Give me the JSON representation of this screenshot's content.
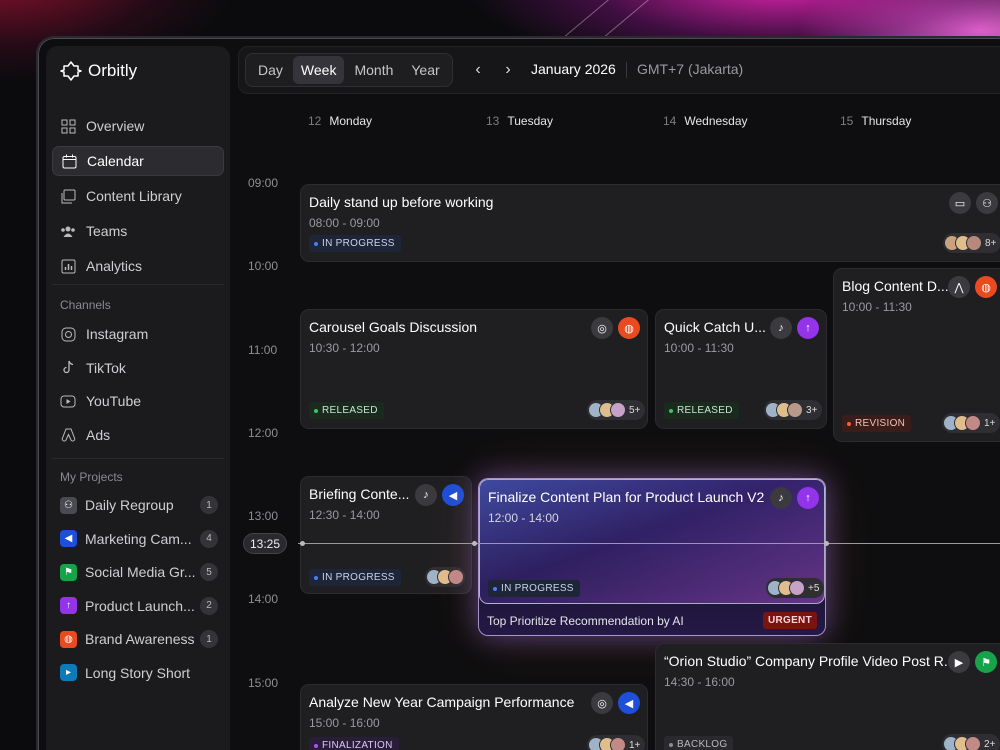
{
  "app": {
    "name": "Orbitly"
  },
  "nav": [
    {
      "label": "Overview",
      "icon": "overview-icon",
      "active": false
    },
    {
      "label": "Calendar",
      "icon": "calendar-icon",
      "active": true
    },
    {
      "label": "Content Library",
      "icon": "library-icon",
      "active": false
    },
    {
      "label": "Teams",
      "icon": "teams-icon",
      "active": false
    },
    {
      "label": "Analytics",
      "icon": "analytics-icon",
      "active": false
    }
  ],
  "channels": {
    "label": "Channels",
    "items": [
      {
        "label": "Instagram",
        "icon": "instagram-icon"
      },
      {
        "label": "TikTok",
        "icon": "tiktok-icon"
      },
      {
        "label": "YouTube",
        "icon": "youtube-icon"
      },
      {
        "label": "Ads",
        "icon": "ads-icon"
      }
    ]
  },
  "projects": {
    "label": "My Projects",
    "items": [
      {
        "label": "Daily Regroup",
        "count": "1",
        "color": "#4a4a52",
        "icon": "teams-icon"
      },
      {
        "label": "Marketing Cam...",
        "count": "4",
        "color": "#1d4fd8",
        "icon": "megaphone-icon"
      },
      {
        "label": "Social Media Gr...",
        "count": "5",
        "color": "#16a34a",
        "icon": "flag-icon"
      },
      {
        "label": "Product Launch...",
        "count": "2",
        "color": "#9333ea",
        "icon": "arrow-up-icon"
      },
      {
        "label": "Brand Awareness",
        "count": "1",
        "color": "#ea4a1f",
        "icon": "globe-icon"
      },
      {
        "label": "Long Story Short",
        "count": "",
        "color": "#0e7ab8",
        "icon": "video-icon"
      }
    ]
  },
  "toolbar": {
    "views": [
      "Day",
      "Week",
      "Month",
      "Year"
    ],
    "active_view": "Week",
    "month": "January 2026",
    "timezone": "GMT+7 (Jakarta)"
  },
  "days": [
    {
      "num": "12",
      "name": "Monday"
    },
    {
      "num": "13",
      "name": "Tuesday"
    },
    {
      "num": "14",
      "name": "Wednesday"
    },
    {
      "num": "15",
      "name": "Thursday"
    }
  ],
  "times": [
    "09:00",
    "10:00",
    "11:00",
    "12:00",
    "13:00",
    "14:00",
    "15:00"
  ],
  "now": "13:25",
  "events": {
    "standup": {
      "title": "Daily stand up before working",
      "time": "08:00 - 09:00",
      "status": "IN PROGRESS",
      "more": "8+"
    },
    "carousel": {
      "title": "Carousel Goals Discussion",
      "time": "10:30 - 12:00",
      "status": "RELEASED",
      "more": "5+"
    },
    "catchup": {
      "title": "Quick Catch U...",
      "time": "10:00 - 11:30",
      "status": "RELEASED",
      "more": "3+"
    },
    "blog": {
      "title": "Blog Content D...",
      "time": "10:00 - 11:30",
      "status": "REVISION",
      "more": "1+"
    },
    "briefing": {
      "title": "Briefing Conte...",
      "time": "12:30 - 14:00",
      "status": "IN PROGRESS"
    },
    "finalize": {
      "title": "Finalize Content Plan for Product Launch V2",
      "time": "12:00 - 14:00",
      "status": "IN PROGRESS",
      "more": "+5",
      "ai_note": "Top Prioritize Recommendation by AI",
      "priority": "URGENT"
    },
    "orion": {
      "title": "“Orion Studio” Company Profile Video Post R...",
      "time": "14:30 - 16:00",
      "status": "BACKLOG",
      "more": "2+"
    },
    "analyze": {
      "title": "Analyze New Year Campaign Performance",
      "time": "15:00 - 16:00",
      "status": "FINALIZATION",
      "more": "1+"
    }
  }
}
